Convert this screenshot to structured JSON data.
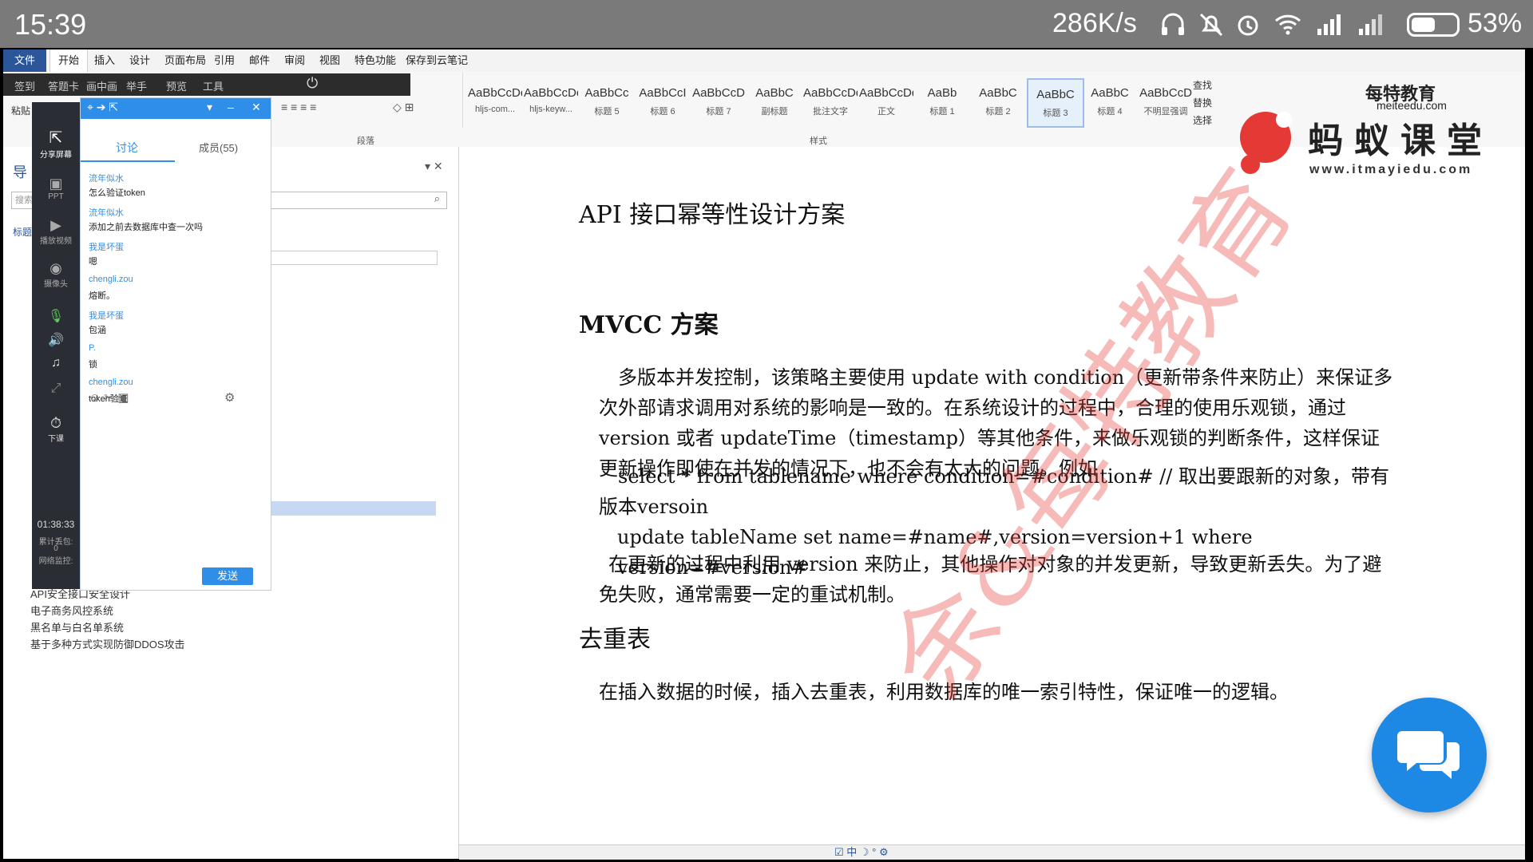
{
  "status": {
    "time": "15:39",
    "speed": "286K/s",
    "battery_pct": "53%",
    "battery_level": 0.53
  },
  "ribbon_tabs": [
    "文件",
    "开始",
    "插入",
    "设计",
    "页面布局",
    "引用",
    "邮件",
    "审阅",
    "视图",
    "特色功能",
    "保存到云笔记"
  ],
  "ribbon": {
    "paste_label": "粘贴",
    "group_paragraph": "段落",
    "group_styles": "样式",
    "styles": [
      {
        "sample": "AaBbCcDc",
        "label": "hljs-com..."
      },
      {
        "sample": "AaBbCcDc",
        "label": "hljs-keyw..."
      },
      {
        "sample": "AaBbCc",
        "label": "标题 5"
      },
      {
        "sample": "AaBbCcI",
        "label": "标题 6"
      },
      {
        "sample": "AaBbCcD",
        "label": "标题 7"
      },
      {
        "sample": "AaBbC",
        "label": "副标题"
      },
      {
        "sample": "AaBbCcDd",
        "label": "批注文字"
      },
      {
        "sample": "AaBbCcDd",
        "label": "正文"
      },
      {
        "sample": "AaBb",
        "label": "标题 1"
      },
      {
        "sample": "AaBbC",
        "label": "标题 2"
      },
      {
        "sample": "AaBbC",
        "label": "标题 3"
      },
      {
        "sample": "AaBbC",
        "label": "标题 4"
      },
      {
        "sample": "AaBbCcD",
        "label": "不明显强调"
      }
    ],
    "find": "查找",
    "replace": "替换",
    "select": "选择"
  },
  "meeting": {
    "toolbar": [
      "签到",
      "答题卡",
      "画中画",
      "举手",
      "预览",
      "工具"
    ],
    "side": [
      {
        "label": "分享屏幕"
      },
      {
        "label": "PPT"
      },
      {
        "label": "播放视频"
      },
      {
        "label": "摄像头"
      },
      {
        "label": "下课"
      }
    ],
    "timer": "01:38:33",
    "stat1": "累计丢包:",
    "stat1_val": "0",
    "stat2": "网络监控:",
    "chat_tabs": {
      "discuss": "讨论",
      "members": "成员(55)"
    },
    "messages": [
      {
        "name": "流年似水",
        "text": "怎么验证token"
      },
      {
        "name": "流年似水",
        "text": "添加之前去数据库中查一次吗"
      },
      {
        "name": "我是坏蛋",
        "text": "嗯"
      },
      {
        "name": "chengli.zou",
        "text": "熔断。"
      },
      {
        "name": "我是坏蛋",
        "text": "包涵"
      },
      {
        "name": "P.",
        "text": "锁"
      },
      {
        "name": "chengli.zou",
        "text": "token验证"
      }
    ],
    "send_label": "发送"
  },
  "nav": {
    "title": "导",
    "search_placeholder": "搜索",
    "heading_tab": "标题",
    "items": [
      "API安全接口安全设计",
      "电子商务风控系统",
      "黑名单与白名单系统",
      "基于多种方式实现防御DDOS攻击"
    ]
  },
  "document": {
    "h1": "API 接口幂等性设计方案",
    "h2": "MVCC 方案",
    "p1": "多版本并发控制，该策略主要使用 update with condition（更新带条件来防止）来保证多次外部请求调用对系统的影响是一致的。在系统设计的过程中，合理的使用乐观锁，通过 version 或者 updateTime（timestamp）等其他条件，来做乐观锁的判断条件，这样保证更新操作即使在并发的情况下，也不会有太大的问题。例如",
    "code1": "select * from tablename where condition=#condition# // 取出要跟新的对象，带有版本versoin",
    "code2": "update tableName set name=#name#,version=version+1 where version=#version#",
    "p2": "在更新的过程中利用 version 来防止，其他操作对对象的并发更新，导致更新丢失。为了避免失败，通常需要一定的重试机制。",
    "h3": "去重表",
    "p3": "在插入数据的时候，插入去重表，利用数据库的唯一索引特性，保证唯一的逻辑。"
  },
  "watermark": {
    "brand_top": "每特教育",
    "brand_url_top": "meiteedu.com",
    "brand_main": "蚂蚁课堂",
    "brand_url": "www.itmayiedu.com",
    "diagonal": "余&每特教育"
  },
  "colors": {
    "accent": "#2b579a",
    "chat_blue": "#2f8fe8",
    "watermark_red": "#e53935"
  }
}
